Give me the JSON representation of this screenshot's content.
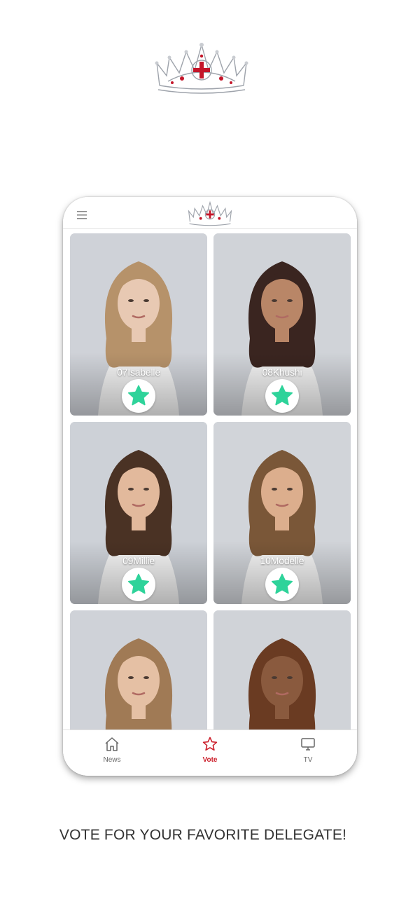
{
  "logo": {
    "icon": "crown-logo"
  },
  "header": {
    "menu_icon": "hamburger-menu-icon",
    "logo_icon": "crown-logo"
  },
  "delegates": [
    {
      "label": "07Isabelle",
      "hair": "#b6926a",
      "skin": "#e8c9b3",
      "shirt": "#f4f4f4",
      "bg": "#cfd2d8"
    },
    {
      "label": "08Khushi",
      "hair": "#3a2520",
      "skin": "#b98667",
      "shirt": "#f3f3f3",
      "bg": "#d0d3d8"
    },
    {
      "label": "09Millie",
      "hair": "#4a3224",
      "skin": "#e2b99c",
      "shirt": "#f4f4f4",
      "bg": "#cdd1d7"
    },
    {
      "label": "10Modelle",
      "hair": "#7a5738",
      "skin": "#dcae8d",
      "shirt": "#f4f4f4",
      "bg": "#d1d4d9"
    },
    {
      "label": "",
      "hair": "#a07a55",
      "skin": "#e5c0a4",
      "shirt": "#f4f4f4",
      "bg": "#cfd2d8"
    },
    {
      "label": "",
      "hair": "#6a3b22",
      "skin": "#8a5a3e",
      "shirt": "#f4f4f4",
      "bg": "#d0d3d8"
    }
  ],
  "vote_icon": "star-icon",
  "colors": {
    "star": "#2ed39a",
    "accent": "#cc1f2b",
    "inactive": "#666666"
  },
  "tabs": [
    {
      "label": "News",
      "icon": "home-icon",
      "active": false
    },
    {
      "label": "Vote",
      "icon": "star-outline-icon",
      "active": true
    },
    {
      "label": "TV",
      "icon": "monitor-icon",
      "active": false
    }
  ],
  "tagline": "VOTE FOR YOUR FAVORITE DELEGATE!"
}
